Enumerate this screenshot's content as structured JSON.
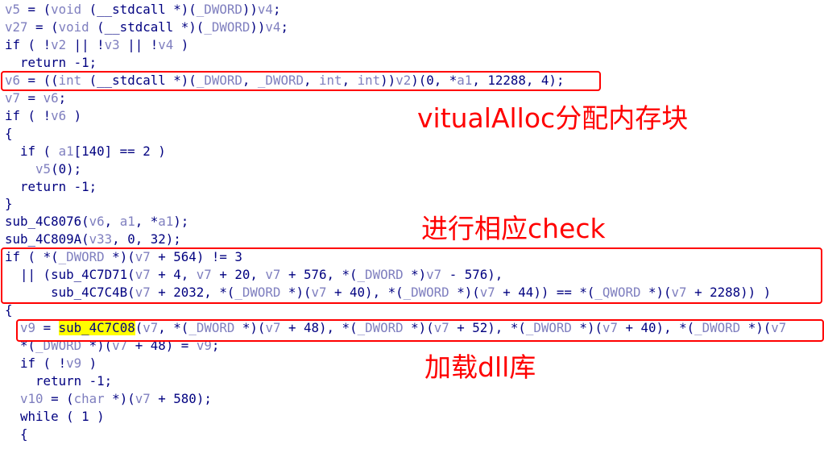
{
  "code_lines": [
    [
      [
        "v5",
        "var"
      ],
      [
        " = (",
        "op"
      ],
      [
        "void",
        "type"
      ],
      [
        " (__stdcall *)(",
        "op"
      ],
      [
        "_DWORD",
        "type"
      ],
      [
        "))",
        "op"
      ],
      [
        "v4",
        "var"
      ],
      [
        ";",
        "op"
      ]
    ],
    [
      [
        "v27",
        "var"
      ],
      [
        " = (",
        "op"
      ],
      [
        "void",
        "type"
      ],
      [
        " (__stdcall *)(",
        "op"
      ],
      [
        "_DWORD",
        "type"
      ],
      [
        "))",
        "op"
      ],
      [
        "v4",
        "var"
      ],
      [
        ";",
        "op"
      ]
    ],
    [
      [
        "if",
        "kw"
      ],
      [
        " ( !",
        "op"
      ],
      [
        "v2",
        "var"
      ],
      [
        " || !",
        "op"
      ],
      [
        "v3",
        "var"
      ],
      [
        " || !",
        "op"
      ],
      [
        "v4",
        "var"
      ],
      [
        " )",
        "op"
      ]
    ],
    [
      [
        "  return -1;",
        "kw"
      ]
    ],
    [
      [
        "v6",
        "var"
      ],
      [
        " = ((",
        "op"
      ],
      [
        "int",
        "type"
      ],
      [
        " (__stdcall *)(",
        "op"
      ],
      [
        "_DWORD",
        "type"
      ],
      [
        ", ",
        "op"
      ],
      [
        "_DWORD",
        "type"
      ],
      [
        ", ",
        "op"
      ],
      [
        "int",
        "type"
      ],
      [
        ", ",
        "op"
      ],
      [
        "int",
        "type"
      ],
      [
        "))",
        "op"
      ],
      [
        "v2",
        "var"
      ],
      [
        ")(0, *",
        "op"
      ],
      [
        "a1",
        "var"
      ],
      [
        ", 12288, 4);",
        "op"
      ]
    ],
    [
      [
        "v7",
        "var"
      ],
      [
        " = ",
        "op"
      ],
      [
        "v6",
        "var"
      ],
      [
        ";",
        "op"
      ]
    ],
    [
      [
        "if",
        "kw"
      ],
      [
        " ( !",
        "op"
      ],
      [
        "v6",
        "var"
      ],
      [
        " )",
        "op"
      ]
    ],
    [
      [
        "{",
        "op"
      ]
    ],
    [
      [
        "  if ( ",
        "kw"
      ],
      [
        "a1",
        "var"
      ],
      [
        "[140] == 2 )",
        "op"
      ]
    ],
    [
      [
        "    ",
        "op"
      ],
      [
        "v5",
        "var"
      ],
      [
        "(0);",
        "op"
      ]
    ],
    [
      [
        "  return -1;",
        "kw"
      ]
    ],
    [
      [
        "}",
        "op"
      ]
    ],
    [
      [
        "sub_4C8076(",
        "fn"
      ],
      [
        "v6",
        "var"
      ],
      [
        ", ",
        "op"
      ],
      [
        "a1",
        "var"
      ],
      [
        ", *",
        "op"
      ],
      [
        "a1",
        "var"
      ],
      [
        ");",
        "op"
      ]
    ],
    [
      [
        "sub_4C809A(",
        "fn"
      ],
      [
        "v33",
        "var"
      ],
      [
        ", 0, 32);",
        "op"
      ]
    ],
    [
      [
        "if",
        "kw"
      ],
      [
        " ( *(",
        "op"
      ],
      [
        "_DWORD",
        "type"
      ],
      [
        " *)(",
        "op"
      ],
      [
        "v7",
        "var"
      ],
      [
        " + 564) != 3",
        "op"
      ]
    ],
    [
      [
        "  || (sub_4C7D71(",
        "fn"
      ],
      [
        "v7",
        "var"
      ],
      [
        " + 4, ",
        "op"
      ],
      [
        "v7",
        "var"
      ],
      [
        " + 20, ",
        "op"
      ],
      [
        "v7",
        "var"
      ],
      [
        " + 576, *(",
        "op"
      ],
      [
        "_DWORD",
        "type"
      ],
      [
        " *)",
        "op"
      ],
      [
        "v7",
        "var"
      ],
      [
        " - 576),",
        "op"
      ]
    ],
    [
      [
        "      sub_4C7C4B(",
        "fn"
      ],
      [
        "v7",
        "var"
      ],
      [
        " + 2032, *(",
        "op"
      ],
      [
        "_DWORD",
        "type"
      ],
      [
        " *)(",
        "op"
      ],
      [
        "v7",
        "var"
      ],
      [
        " + 40), *(",
        "op"
      ],
      [
        "_DWORD",
        "type"
      ],
      [
        " *)(",
        "op"
      ],
      [
        "v7",
        "var"
      ],
      [
        " + 44)) == *(",
        "op"
      ],
      [
        "_QWORD",
        "type"
      ],
      [
        " *)(",
        "op"
      ],
      [
        "v7",
        "var"
      ],
      [
        " + 2288)) )",
        "op"
      ]
    ],
    [
      [
        "{",
        "op"
      ]
    ],
    [
      [
        "  ",
        "op"
      ],
      [
        "v9",
        "var"
      ],
      [
        " = ",
        "op"
      ],
      [
        "sub_4C7C08",
        "hl"
      ],
      [
        "(",
        "op"
      ],
      [
        "v7",
        "var"
      ],
      [
        ", *(",
        "op"
      ],
      [
        "_DWORD",
        "type"
      ],
      [
        " *)(",
        "op"
      ],
      [
        "v7",
        "var"
      ],
      [
        " + 48), *(",
        "op"
      ],
      [
        "_DWORD",
        "type"
      ],
      [
        " *)(",
        "op"
      ],
      [
        "v7",
        "var"
      ],
      [
        " + 52), *(",
        "op"
      ],
      [
        "_DWORD",
        "type"
      ],
      [
        " *)(",
        "op"
      ],
      [
        "v7",
        "var"
      ],
      [
        " + 40), *(",
        "op"
      ],
      [
        "_DWORD",
        "type"
      ],
      [
        " *)(",
        "op"
      ],
      [
        "v7",
        "var"
      ]
    ],
    [
      [
        "  *(",
        "op"
      ],
      [
        "_DWORD",
        "type"
      ],
      [
        " *)(",
        "op"
      ],
      [
        "v7",
        "var"
      ],
      [
        " + 48) = ",
        "op"
      ],
      [
        "v9",
        "var"
      ],
      [
        ";",
        "op"
      ]
    ],
    [
      [
        "  if ( !",
        "kw"
      ],
      [
        "v9",
        "var"
      ],
      [
        " )",
        "op"
      ]
    ],
    [
      [
        "    return -1;",
        "kw"
      ]
    ],
    [
      [
        "  ",
        "op"
      ],
      [
        "v10",
        "var"
      ],
      [
        " = (",
        "op"
      ],
      [
        "char",
        "type"
      ],
      [
        " *)(",
        "op"
      ],
      [
        "v7",
        "var"
      ],
      [
        " + 580);",
        "op"
      ]
    ],
    [
      [
        "  while ( 1 )",
        "kw"
      ]
    ],
    [
      [
        "  {",
        "op"
      ]
    ]
  ],
  "annotations": {
    "alloc": "vitualAlloc分配内存块",
    "check": "进行相应check",
    "load": "加载dll库"
  },
  "colors": {
    "annotation": "#ff0000",
    "highlight": "#ffff00",
    "code_text": "#000080",
    "identifier": "#7f7fbf"
  }
}
